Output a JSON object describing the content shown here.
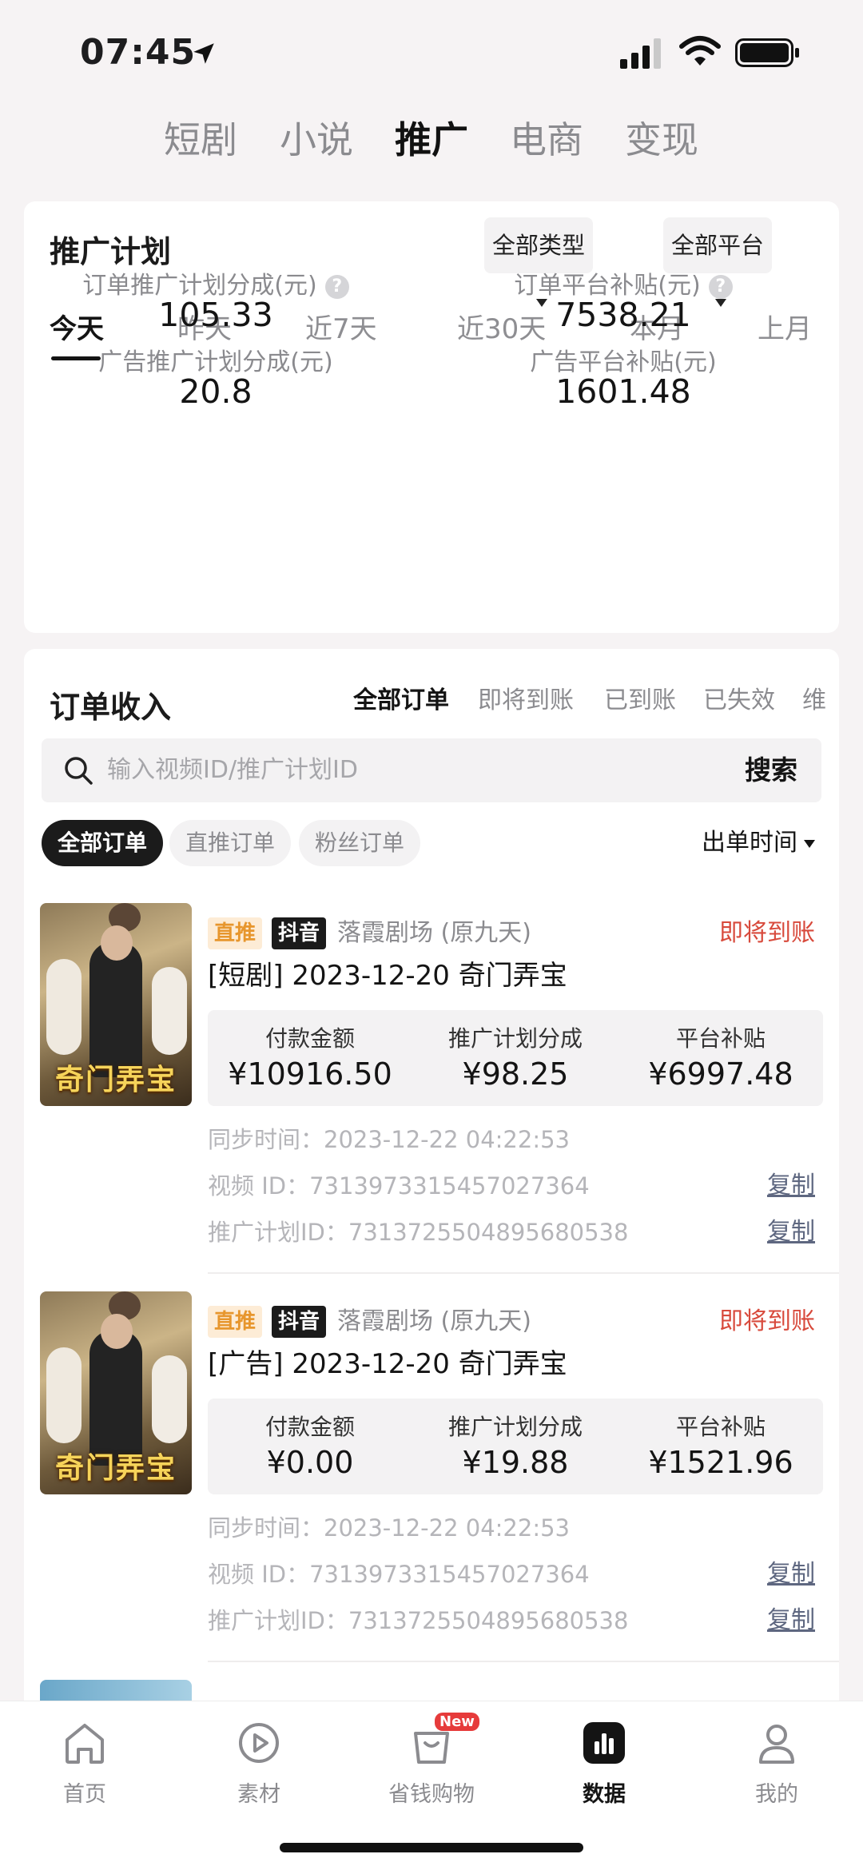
{
  "status_bar": {
    "time": "07:45"
  },
  "top_tabs": [
    {
      "label": "短剧",
      "active": false
    },
    {
      "label": "小说",
      "active": false
    },
    {
      "label": "推广",
      "active": true
    },
    {
      "label": "电商",
      "active": false
    },
    {
      "label": "变现",
      "active": false
    }
  ],
  "plan": {
    "title": "推广计划",
    "type_filter": "全部类型",
    "platform_filter": "全部平台",
    "date_tabs": [
      "今天",
      "昨天",
      "近7天",
      "近30天",
      "本月",
      "上月"
    ],
    "active_date_tab": "今天",
    "metrics": [
      {
        "label": "订单推广计划分成(元)",
        "value": "105.33",
        "help": true
      },
      {
        "label": "订单平台补贴(元)",
        "value": "7538.21",
        "help": true
      },
      {
        "label": "广告推广计划分成(元)",
        "value": "20.8",
        "help": false
      },
      {
        "label": "广告平台补贴(元)",
        "value": "1601.48",
        "help": false
      }
    ]
  },
  "orders": {
    "title": "订单收入",
    "status_filters": [
      "全部订单",
      "即将到账",
      "已到账",
      "已失效",
      "维"
    ],
    "search": {
      "placeholder": "输入视频ID/推广计划ID",
      "button": "搜索"
    },
    "chips": [
      "全部订单",
      "直推订单",
      "粉丝订单"
    ],
    "sort_label": "出单时间",
    "items": [
      {
        "thumb_title": "奇门弄宝",
        "tag_type": "直推",
        "tag_platform": "抖音",
        "source": "落霞剧场 (原九天)",
        "status": "即将到账",
        "title": "[短剧] 2023-12-20 奇门弄宝",
        "amount_labels": [
          "付款金额",
          "推广计划分成",
          "平台补贴"
        ],
        "amounts": [
          "¥10916.50",
          "¥98.25",
          "¥6997.48"
        ],
        "sync_time": "同步时间：2023-12-22 04:22:53",
        "video_id": "视频 ID：7313973315457027364",
        "plan_id": "推广计划ID：7313725504895680538",
        "copy_label": "复制"
      },
      {
        "thumb_title": "奇门弄宝",
        "tag_type": "直推",
        "tag_platform": "抖音",
        "source": "落霞剧场 (原九天)",
        "status": "即将到账",
        "title": "[广告] 2023-12-20 奇门弄宝",
        "amount_labels": [
          "付款金额",
          "推广计划分成",
          "平台补贴"
        ],
        "amounts": [
          "¥0.00",
          "¥19.88",
          "¥1521.96"
        ],
        "sync_time": "同步时间：2023-12-22 04:22:53",
        "video_id": "视频 ID：7313973315457027364",
        "plan_id": "推广计划ID：7313725504895680538",
        "copy_label": "复制"
      }
    ]
  },
  "bottom_nav": [
    {
      "label": "首页",
      "icon": "home-icon",
      "active": false
    },
    {
      "label": "素材",
      "icon": "video-icon",
      "active": false
    },
    {
      "label": "省钱购物",
      "icon": "shopping-bag-icon",
      "active": false,
      "badge": "New"
    },
    {
      "label": "数据",
      "icon": "data-chart-icon",
      "active": true
    },
    {
      "label": "我的",
      "icon": "profile-icon",
      "active": false
    }
  ],
  "colors": {
    "accent_red": "#d84a3c",
    "tag_orange": "#e7962d",
    "link": "#5e6780"
  }
}
